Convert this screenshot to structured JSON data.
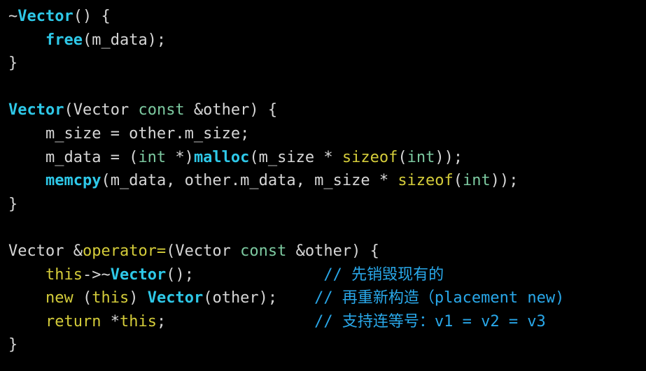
{
  "colors": {
    "background": "#000000",
    "plain_text": "#d6d6d6",
    "function_name": "#2ec8e8",
    "keyword": "#d4cc3a",
    "type": "#7cc9a0",
    "comment": "#29a8ea"
  },
  "code_lines": [
    [
      {
        "text": "~",
        "kind": "plain"
      },
      {
        "text": "Vector",
        "kind": "fn"
      },
      {
        "text": "() {",
        "kind": "plain"
      }
    ],
    [
      {
        "text": "    ",
        "kind": "plain"
      },
      {
        "text": "free",
        "kind": "fn"
      },
      {
        "text": "(m_data);",
        "kind": "plain"
      }
    ],
    [
      {
        "text": "}",
        "kind": "plain"
      }
    ],
    [],
    [
      {
        "text": "Vector",
        "kind": "fn"
      },
      {
        "text": "(Vector ",
        "kind": "plain"
      },
      {
        "text": "const",
        "kind": "type"
      },
      {
        "text": " &other) {",
        "kind": "plain"
      }
    ],
    [
      {
        "text": "    m_size = other.m_size;",
        "kind": "plain"
      }
    ],
    [
      {
        "text": "    m_data = (",
        "kind": "plain"
      },
      {
        "text": "int",
        "kind": "type"
      },
      {
        "text": " *)",
        "kind": "plain"
      },
      {
        "text": "malloc",
        "kind": "fn"
      },
      {
        "text": "(m_size * ",
        "kind": "plain"
      },
      {
        "text": "sizeof",
        "kind": "kw"
      },
      {
        "text": "(",
        "kind": "plain"
      },
      {
        "text": "int",
        "kind": "type"
      },
      {
        "text": "));",
        "kind": "plain"
      }
    ],
    [
      {
        "text": "    ",
        "kind": "plain"
      },
      {
        "text": "memcpy",
        "kind": "fn"
      },
      {
        "text": "(m_data, other.m_data, m_size * ",
        "kind": "plain"
      },
      {
        "text": "sizeof",
        "kind": "kw"
      },
      {
        "text": "(",
        "kind": "plain"
      },
      {
        "text": "int",
        "kind": "type"
      },
      {
        "text": "));",
        "kind": "plain"
      }
    ],
    [
      {
        "text": "}",
        "kind": "plain"
      }
    ],
    [],
    [
      {
        "text": "Vector &",
        "kind": "plain"
      },
      {
        "text": "operator=",
        "kind": "kw"
      },
      {
        "text": "(Vector ",
        "kind": "plain"
      },
      {
        "text": "const",
        "kind": "type"
      },
      {
        "text": " &other) {",
        "kind": "plain"
      }
    ],
    [
      {
        "text": "    ",
        "kind": "plain"
      },
      {
        "text": "this",
        "kind": "kw"
      },
      {
        "text": "->~",
        "kind": "plain"
      },
      {
        "text": "Vector",
        "kind": "fn"
      },
      {
        "text": "();              ",
        "kind": "plain"
      },
      {
        "text": "// 先销毁现有的",
        "kind": "comment"
      }
    ],
    [
      {
        "text": "    ",
        "kind": "plain"
      },
      {
        "text": "new",
        "kind": "kw"
      },
      {
        "text": " (",
        "kind": "plain"
      },
      {
        "text": "this",
        "kind": "kw"
      },
      {
        "text": ") ",
        "kind": "plain"
      },
      {
        "text": "Vector",
        "kind": "fn"
      },
      {
        "text": "(other);    ",
        "kind": "plain"
      },
      {
        "text": "// 再重新构造（placement new)",
        "kind": "comment"
      }
    ],
    [
      {
        "text": "    ",
        "kind": "plain"
      },
      {
        "text": "return",
        "kind": "kw"
      },
      {
        "text": " *",
        "kind": "plain"
      },
      {
        "text": "this",
        "kind": "kw"
      },
      {
        "text": ";                ",
        "kind": "plain"
      },
      {
        "text": "// 支持连等号：v1 = v2 = v3",
        "kind": "comment"
      }
    ],
    [
      {
        "text": "}",
        "kind": "plain"
      }
    ]
  ]
}
